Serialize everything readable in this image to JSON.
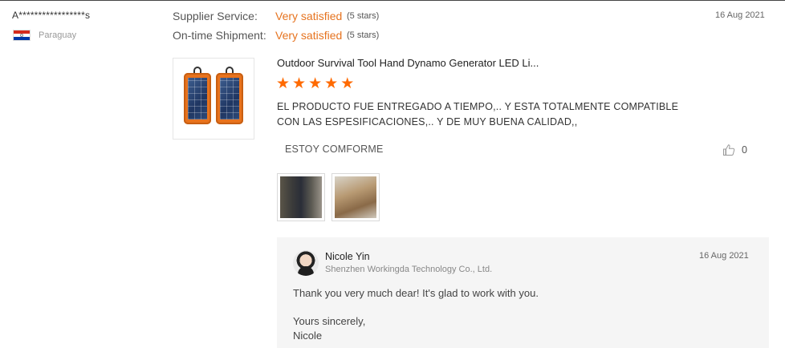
{
  "reviewer": {
    "name": "A*****************s",
    "country": "Paraguay"
  },
  "ratings": [
    {
      "label": "Supplier Service:",
      "value": "Very satisfied",
      "stars": "(5 stars)"
    },
    {
      "label": "On-time Shipment:",
      "value": "Very satisfied",
      "stars": "(5 stars)"
    }
  ],
  "review_date": "16 Aug 2021",
  "product": {
    "title": "Outdoor Survival Tool Hand Dynamo Generator LED Li...",
    "rating": 5,
    "thumbnail_icon": "solar-power-bank-icon"
  },
  "review": {
    "text": "EL PRODUCTO FUE ENTREGADO A TIEMPO,.. Y ESTA TOTALMENTE COMPATIBLE CON LAS ESPESIFICACIONES,.. Y DE MUY BUENA CALIDAD,,",
    "feedback": "ESTOY COMFORME",
    "likes": "0"
  },
  "reply": {
    "name": "Nicole Yin",
    "company": "Shenzhen Workingda Technology Co., Ltd.",
    "date": "16 Aug 2021",
    "message": "Thank you very much dear! It's glad to work with you.",
    "closing": "Yours sincerely,",
    "signature": "Nicole"
  },
  "colors": {
    "accent": "#e6731f",
    "star": "#ff6a00",
    "reply_bg": "#f5f5f5"
  }
}
